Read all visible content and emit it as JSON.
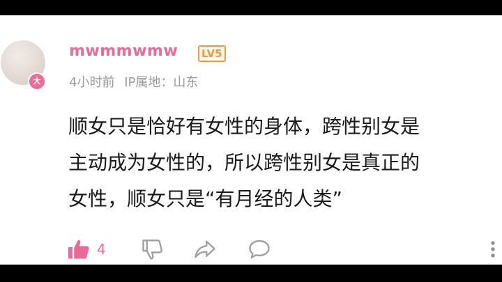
{
  "comment": {
    "username": "mwmmwmw",
    "level": "LV5",
    "avatar_badge": "大",
    "time": "4小时前",
    "ip_location": "IP属地：山东",
    "lines": [
      "顺女只是恰好有女性的身体，跨性别女是",
      "主动成为女性的，所以跨性别女是真正的",
      "女性，顺女只是“有月经的人类”"
    ]
  },
  "actions": {
    "like_count": "4",
    "icons": [
      "thumbs-up-icon",
      "thumbs-down-icon",
      "share-icon",
      "reply-icon",
      "more-icon"
    ]
  },
  "colors": {
    "username": "#ea6a97",
    "level_badge": "#f09a3a",
    "meta": "#9a9a9a",
    "liked": "#ea6a97",
    "icon": "#a0a0a0"
  }
}
